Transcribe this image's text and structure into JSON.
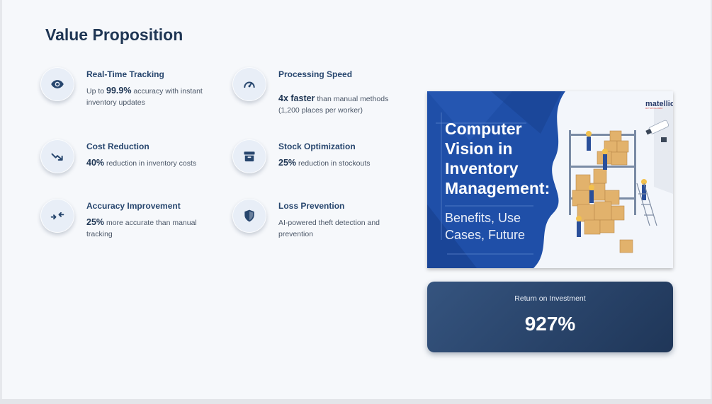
{
  "page": {
    "title": "Value Proposition"
  },
  "features": [
    {
      "title": "Real-Time Tracking",
      "pre": "Up to ",
      "highlight": "99.9%",
      "post": " accuracy with instant inventory updates",
      "icon": "eye-icon"
    },
    {
      "title": "Processing Speed",
      "pre": "",
      "highlight": "4x faster",
      "post": " than manual methods (1,200 places per worker)",
      "icon": "speedometer-icon"
    },
    {
      "title": "Cost Reduction",
      "pre": "",
      "highlight": "40%",
      "post": " reduction in inventory costs",
      "icon": "trend-down-icon"
    },
    {
      "title": "Stock Optimization",
      "pre": "",
      "highlight": "25%",
      "post": " reduction in stockouts",
      "icon": "archive-box-icon"
    },
    {
      "title": "Accuracy Improvement",
      "pre": "",
      "highlight": "25%",
      "post": " more accurate than manual tracking",
      "icon": "compress-arrows-icon"
    },
    {
      "title": "Loss Prevention",
      "pre": "",
      "highlight": "",
      "post": "AI-powered theft detection and prevention",
      "icon": "shield-icon"
    }
  ],
  "hero": {
    "brand": "matellio",
    "brand_tagline": "MOTIVATING IDEAS",
    "heading_lines": [
      "Computer",
      "Vision in",
      "Inventory",
      "Management:"
    ],
    "sub_lines": [
      "Benefits, Use",
      "Cases, Future"
    ]
  },
  "roi": {
    "label": "Return on Investment",
    "value": "927%"
  },
  "colors": {
    "primary": "#1f3654",
    "accent": "#27466e",
    "hero_blue": "#1f4fa8",
    "box": "#e2b26c"
  }
}
